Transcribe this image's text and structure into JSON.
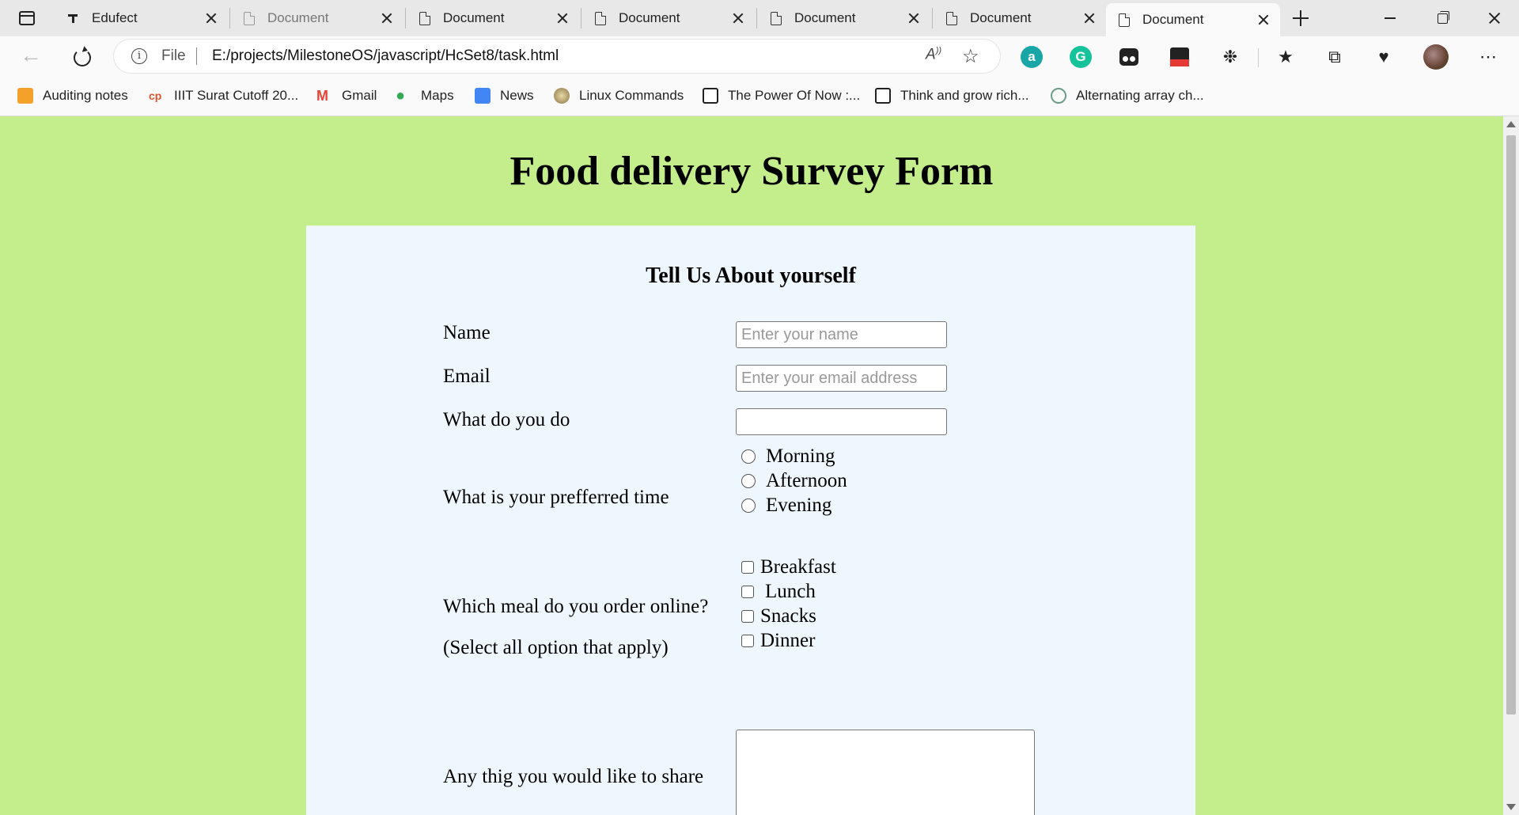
{
  "browser": {
    "tabs": [
      {
        "label": "Edufect",
        "icon": "edufect-icon"
      },
      {
        "label": "Document",
        "icon": "document-icon"
      },
      {
        "label": "Document",
        "icon": "document-icon"
      },
      {
        "label": "Document",
        "icon": "document-icon"
      },
      {
        "label": "Document",
        "icon": "document-icon"
      },
      {
        "label": "Document",
        "icon": "document-icon"
      },
      {
        "label": "Document",
        "icon": "document-icon",
        "active": true
      }
    ],
    "address": {
      "scheme_label": "File",
      "url": "E:/projects/MilestoneOS/javascript/HcSet8/task.html"
    },
    "bookmarks": [
      {
        "label": "Auditing notes",
        "color": "#f4a12c"
      },
      {
        "label": "IIIT Surat Cutoff 20...",
        "color": "#e0552e"
      },
      {
        "label": "Gmail",
        "color": "#ea4335"
      },
      {
        "label": "Maps",
        "color": "#34a853"
      },
      {
        "label": "News",
        "color": "#4285f4"
      },
      {
        "label": "Linux Commands",
        "color": "#a08a52"
      },
      {
        "label": "The Power Of Now :...",
        "color": "#222222"
      },
      {
        "label": "Think and grow rich...",
        "color": "#222222"
      },
      {
        "label": "Alternating array ch...",
        "color": "#6b9e88"
      }
    ],
    "extensions": [
      {
        "name": "amazon-assistant-icon",
        "color": "#1aa6a6",
        "glyph": "a"
      },
      {
        "name": "grammarly-icon",
        "color": "#15c39a",
        "glyph": "G"
      }
    ]
  },
  "page": {
    "background": "#c4ed8c",
    "title": "Food delivery Survey Form",
    "form": {
      "section_title": "Tell Us About yourself",
      "name_label": "Name",
      "name_placeholder": "Enter your name",
      "email_label": "Email",
      "email_placeholder": "Enter your email address",
      "occupation_label": "What do you do",
      "time_label": "What is your prefferred time",
      "time_options": [
        "Morning",
        "Afternoon",
        "Evening"
      ],
      "meal_label": "Which meal do you order online?",
      "meal_hint": "(Select all option that apply)",
      "meal_options": [
        "Breakfast",
        "Lunch",
        "Snacks",
        "Dinner"
      ],
      "share_label": "Any thig you would like to share"
    }
  }
}
